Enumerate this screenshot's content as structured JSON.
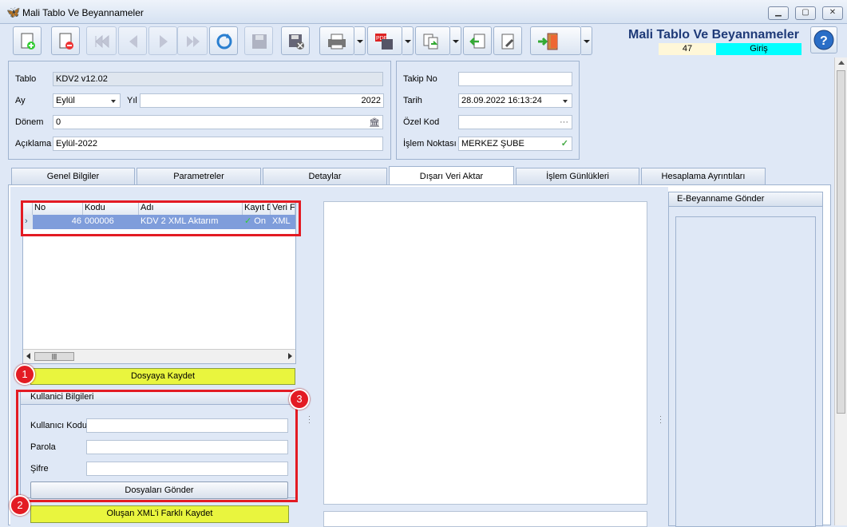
{
  "window": {
    "title": "Mali Tablo Ve Beyannameler",
    "minimize": "▁",
    "maximize": "▢",
    "close": "✕"
  },
  "header": {
    "title": "Mali Tablo Ve Beyannameler",
    "record_no": "47",
    "mode": "Giriş"
  },
  "form": {
    "tablo_label": "Tablo",
    "tablo_value": "KDV2 v12.02",
    "ay_label": "Ay",
    "ay_value": "Eylül",
    "yil_label": "Yıl",
    "yil_value": "2022",
    "donem_label": "Dönem",
    "donem_value": "0",
    "aciklama_label": "Açıklama",
    "aciklama_value": "Eylül-2022",
    "takip_label": "Takip No",
    "takip_value": "",
    "tarih_label": "Tarih",
    "tarih_value": "28.09.2022 16:13:24",
    "ozel_label": "Özel Kod",
    "ozel_value": "",
    "islem_label": "İşlem Noktası",
    "islem_value": "MERKEZ ŞUBE"
  },
  "tabs": [
    "Genel Bilgiler",
    "Parametreler",
    "Detaylar",
    "Dışarı Veri Aktar",
    "İşlem Günlükleri",
    "Hesaplama Ayrıntıları"
  ],
  "grid": {
    "columns": [
      "No",
      "Kodu",
      "Adı",
      "Kayıt D",
      "Veri F"
    ],
    "rows": [
      {
        "no": "46",
        "kodu": "000006",
        "adi": "KDV 2 XML Aktarım",
        "kayit": "On",
        "veri": "XML"
      }
    ]
  },
  "buttons": {
    "dosyaya_kaydet": "Dosyaya Kaydet",
    "dosyalari_gonder": "Dosyaları Gönder",
    "farkli_kaydet": "Oluşan XML'i Farklı Kaydet"
  },
  "kullanici": {
    "title": "Kullanici Bilgileri",
    "kodu_label": "Kullanıcı Kodu",
    "parola_label": "Parola",
    "sifre_label": "Şifre"
  },
  "ebeyanname": {
    "title": "E-Beyanname Gönder"
  },
  "badges": [
    "1",
    "2",
    "3"
  ],
  "colors": {
    "accent_highlight": "#e31b23",
    "yellow_button": "#e9f53e",
    "mode_cyan": "#00ffff",
    "selected_row": "#7f9ddb"
  }
}
